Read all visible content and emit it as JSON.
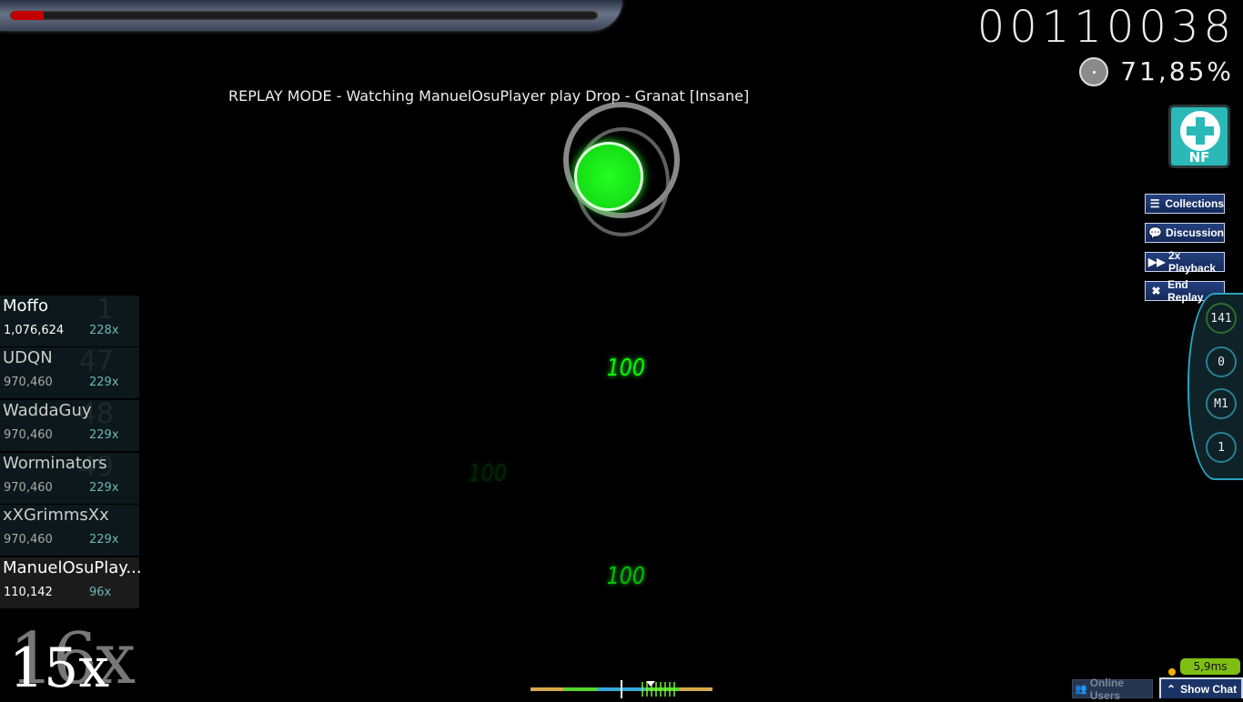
{
  "hud": {
    "health_fraction": 0.055,
    "score": "00110038",
    "accuracy": "71,85%",
    "mod": {
      "label": "NF",
      "name": "No Fail",
      "color": "#2ab8b8"
    },
    "replay_banner": "REPLAY MODE - Watching ManuelOsuPlayer play Drop - Granat [Insane]",
    "combo": "15x",
    "combo_popout": "16x"
  },
  "buttons": {
    "collections": {
      "label": "Collections",
      "icon": "list-icon"
    },
    "discussion": {
      "label": "Discussion",
      "icon": "speech-bubble-icon"
    },
    "playback": {
      "label": "2x Playback",
      "icon": "fast-forward-icon"
    },
    "end_replay": {
      "label": "End Replay",
      "icon": "close-icon"
    }
  },
  "key_overlay": [
    {
      "label": "141",
      "active_color": "#2e6e2a"
    },
    {
      "label": "0"
    },
    {
      "label": "M1"
    },
    {
      "label": "1"
    }
  ],
  "judgements": [
    "100",
    "100",
    "100"
  ],
  "leaderboard": [
    {
      "rank": "1",
      "name": "Moffo",
      "score": "1,076,624",
      "combo": "228x"
    },
    {
      "rank": "47",
      "name": "UDQN",
      "score": "970,460",
      "combo": "229x"
    },
    {
      "rank": "48",
      "name": "WaddaGuy",
      "score": "970,460",
      "combo": "229x"
    },
    {
      "rank": "49",
      "name": "Worminators",
      "score": "970,460",
      "combo": "229x"
    },
    {
      "rank": "",
      "name": "xXGrimmsXx",
      "score": "970,460",
      "combo": "229x"
    },
    {
      "rank": "",
      "name": "ManuelOsuPlay...",
      "score": "110,142",
      "combo": "96x"
    }
  ],
  "hit_error_bar": {
    "colors": {
      "meh": "#d9a84e",
      "good": "#57d62c",
      "great": "#34a8df"
    }
  },
  "bottom_bar": {
    "ping": "5,9ms",
    "online_users_label": "Online Users",
    "show_chat_label": "Show Chat"
  }
}
